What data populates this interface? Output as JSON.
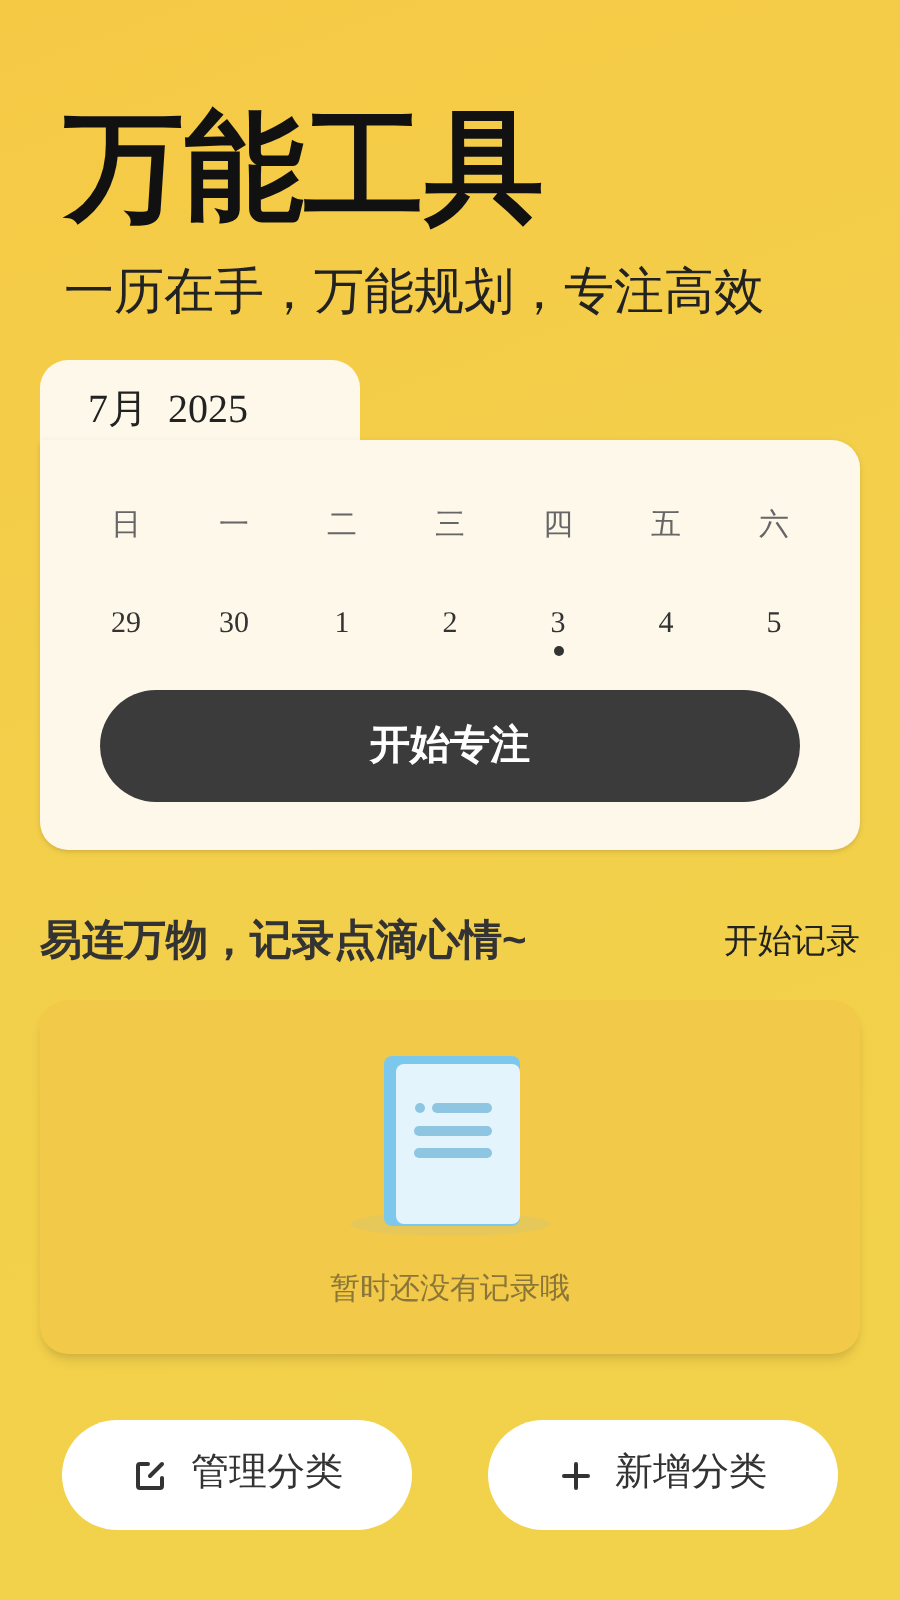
{
  "header": {
    "title": "万能工具",
    "subtitle": "一历在手，万能规划，专注高效"
  },
  "calendar": {
    "month_label": "7月  2025",
    "weekdays": [
      "日",
      "一",
      "二",
      "三",
      "四",
      "五",
      "六"
    ],
    "days": [
      {
        "label": "29",
        "marked": false
      },
      {
        "label": "30",
        "marked": false
      },
      {
        "label": "1",
        "marked": false
      },
      {
        "label": "2",
        "marked": false
      },
      {
        "label": "3",
        "marked": true
      },
      {
        "label": "4",
        "marked": false
      },
      {
        "label": "5",
        "marked": false
      }
    ],
    "button": "开始专注"
  },
  "records": {
    "heading": "易连万物，记录点滴心情~",
    "action": "开始记录",
    "empty_text": "暂时还没有记录哦"
  },
  "buttons": [
    {
      "kind": "edit",
      "label": "管理分类"
    },
    {
      "kind": "add",
      "label": "新增分类"
    }
  ]
}
